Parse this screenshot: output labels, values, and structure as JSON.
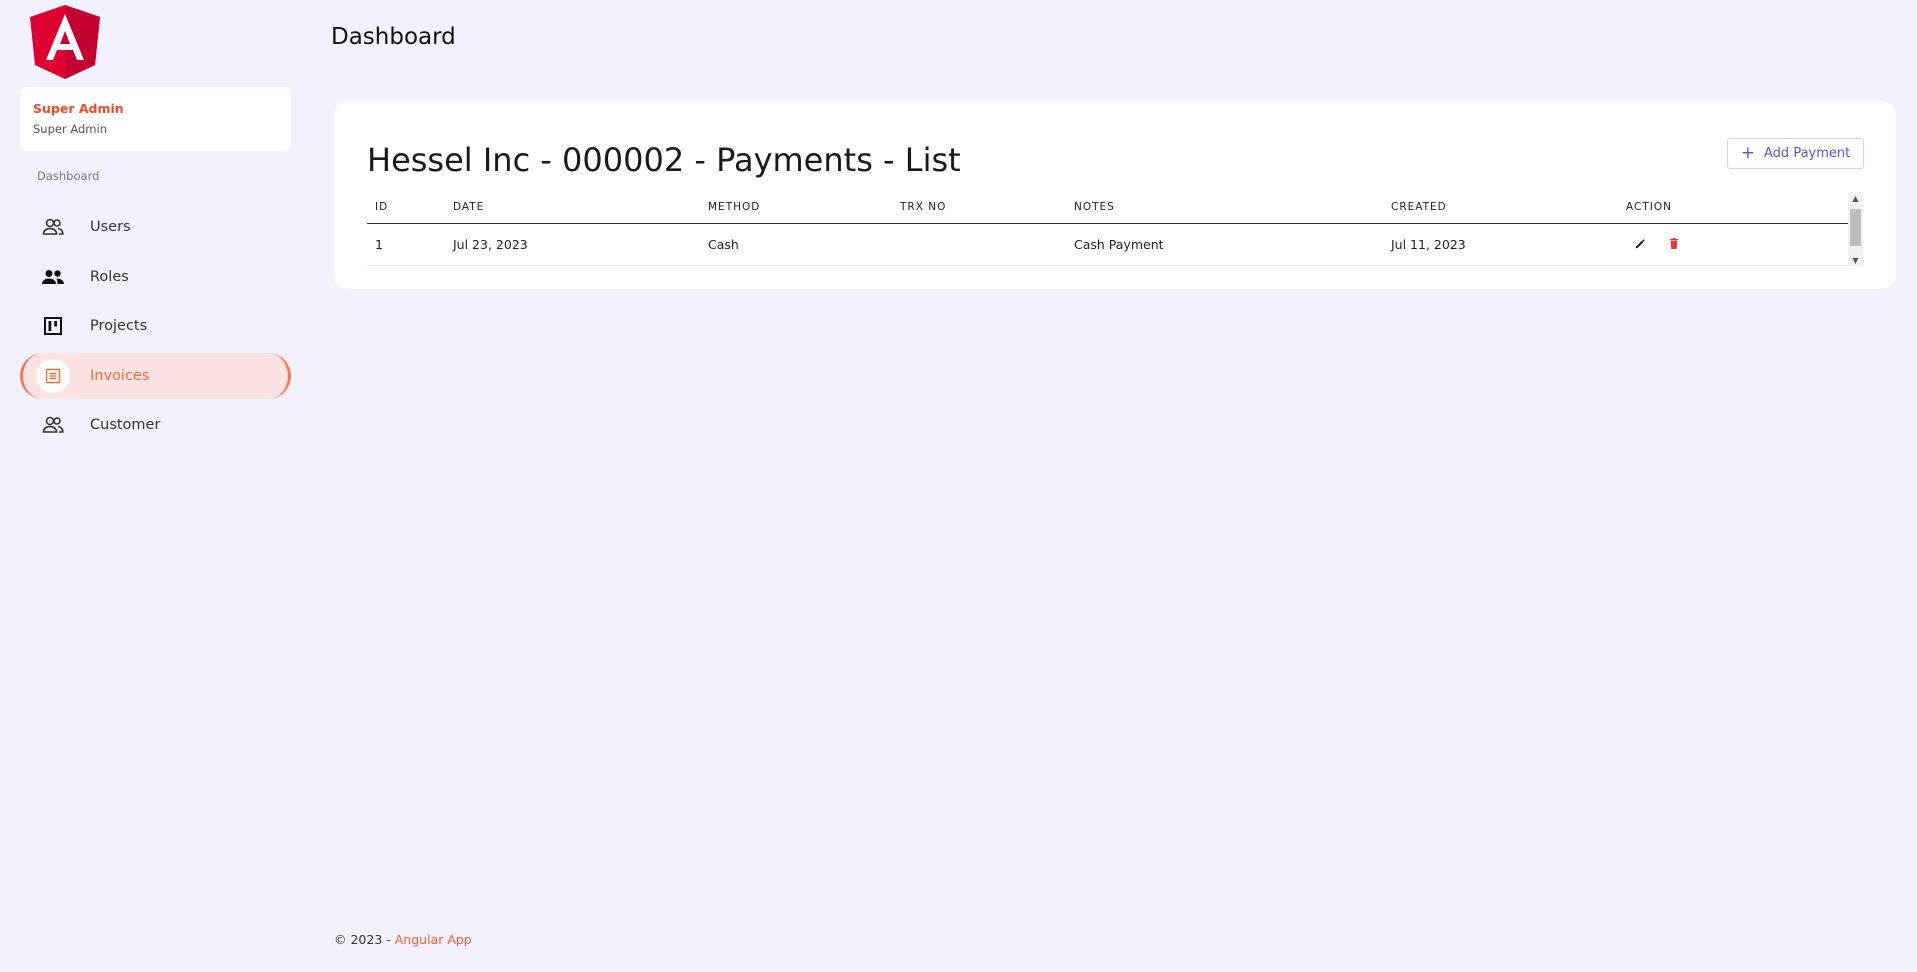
{
  "sidebar": {
    "user": {
      "name": "Super Admin",
      "role": "Super Admin"
    },
    "section_label": "Dashboard",
    "items": [
      {
        "label": "Users",
        "icon": "users-icon",
        "active": false
      },
      {
        "label": "Roles",
        "icon": "roles-icon",
        "active": false
      },
      {
        "label": "Projects",
        "icon": "kanban-board-icon",
        "active": false
      },
      {
        "label": "Invoices",
        "icon": "invoice-icon",
        "active": true
      },
      {
        "label": "Customer",
        "icon": "customer-icon",
        "active": false
      }
    ]
  },
  "header": {
    "title": "Dashboard"
  },
  "main": {
    "title": "Hessel Inc - 000002 - Payments - List",
    "add_button": {
      "icon": "plus-icon",
      "label": "Add Payment"
    },
    "table": {
      "columns": [
        "ID",
        "DATE",
        "METHOD",
        "TRX NO",
        "NOTES",
        "CREATED",
        "ACTION"
      ],
      "rows": [
        {
          "id": "1",
          "date": "Jul 23, 2023",
          "method": "Cash",
          "trx_no": "",
          "notes": "Cash Payment",
          "created": "Jul 11, 2023"
        }
      ]
    }
  },
  "footer": {
    "text": "© 2023 - ",
    "brand": "Angular App"
  },
  "colors": {
    "accent": "#f04a25",
    "active_bg": "#fbe3e4",
    "button_text": "#6a4fc2",
    "background": "#f3f1fd",
    "delete": "#e53935"
  }
}
